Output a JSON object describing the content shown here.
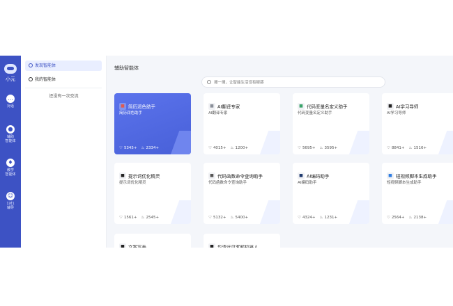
{
  "rail": {
    "name": "小元",
    "items": [
      {
        "label": "对话",
        "icon": "chat-icon"
      },
      {
        "label": "辅助\n智能体",
        "icon": "robot-icon"
      },
      {
        "label": "教学\n智能体",
        "icon": "teacher-icon"
      },
      {
        "label": "1对1\n辅导",
        "icon": "tutor-icon"
      }
    ]
  },
  "sidebar": {
    "items": [
      {
        "label": "发现智能体",
        "active": true
      },
      {
        "label": "我的智能体",
        "active": false
      }
    ],
    "empty_text": "还没有一次交流"
  },
  "main": {
    "title": "辅助智能体",
    "search_placeholder": "搜一搜，让智能生活没有疑惑",
    "cards": [
      {
        "name": "简历润色助手",
        "desc": "简历润色助手",
        "likes": "5345+",
        "heat": "2334+",
        "icon": "resume-icon",
        "icon_color": "#e05a4f",
        "featured": true
      },
      {
        "name": "AI翻译专家",
        "desc": "AI翻译专家",
        "likes": "4015+",
        "heat": "1200+",
        "icon": "translate-icon",
        "icon_color": "#8a8f99",
        "featured": false
      },
      {
        "name": "代码变量名定义助手",
        "desc": "代码变量名定义助手",
        "likes": "5695+",
        "heat": "3595+",
        "icon": "code-var-icon",
        "icon_color": "#3aa36a",
        "featured": false
      },
      {
        "name": "AI学习导师",
        "desc": "AI学习导师",
        "likes": "8841+",
        "heat": "1516+",
        "icon": "graduation-cap-icon",
        "icon_color": "#222222",
        "featured": false
      },
      {
        "name": "提示词优化精灵",
        "desc": "提示词优化精灵",
        "likes": "1561+",
        "heat": "2545+",
        "icon": "prompt-icon",
        "icon_color": "#222222",
        "featured": false
      },
      {
        "name": "代码函数命令查询助手",
        "desc": "代码函数命令查询助手",
        "likes": "5132+",
        "heat": "5400+",
        "icon": "function-icon",
        "icon_color": "#555555",
        "featured": false
      },
      {
        "name": "AI编码助手",
        "desc": "AI编码助手",
        "likes": "4324+",
        "heat": "1231+",
        "icon": "coding-icon",
        "icon_color": "#1f3a6e",
        "featured": false
      },
      {
        "name": "短视频脚本生成助手",
        "desc": "短视频脚本生成助手",
        "likes": "2564+",
        "heat": "2138+",
        "icon": "video-script-icon",
        "icon_color": "#2f7de1",
        "featured": false
      },
      {
        "name": "文案写手",
        "desc": "",
        "likes": "",
        "heat": "",
        "icon": "copywriter-icon",
        "icon_color": "#222222",
        "featured": false
      },
      {
        "name": "华清远见客服机器人",
        "desc": "",
        "likes": "",
        "heat": "",
        "icon": "service-robot-icon",
        "icon_color": "#222222",
        "featured": false
      }
    ]
  },
  "colors": {
    "brand": "#3d52c4",
    "featured_card": "#5069e2",
    "background": "#f4f6fa"
  }
}
